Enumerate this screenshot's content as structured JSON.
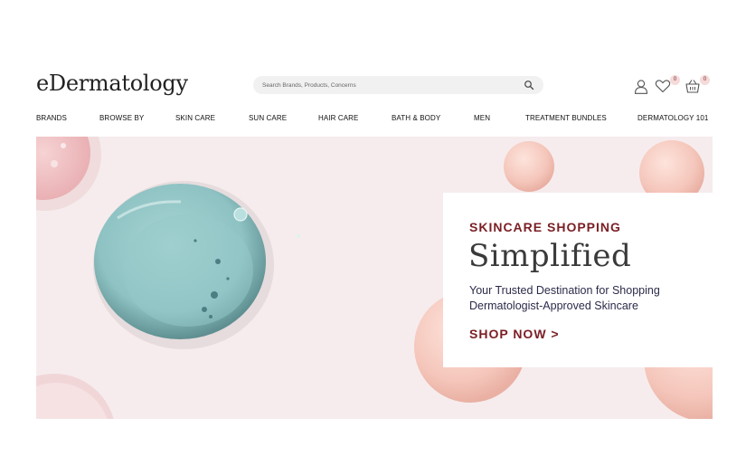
{
  "brand": {
    "logo_text": "eDermatology"
  },
  "search": {
    "placeholder": "Search Brands, Products, Concerns",
    "value": "",
    "icon": "search-icon"
  },
  "header_icons": {
    "account_icon": "user-icon",
    "wishlist_icon": "heart-icon",
    "wishlist_count": "0",
    "cart_icon": "basket-icon",
    "cart_count": "0"
  },
  "nav": {
    "items": [
      {
        "label": "BRANDS"
      },
      {
        "label": "BROWSE BY"
      },
      {
        "label": "SKIN CARE"
      },
      {
        "label": "SUN CARE"
      },
      {
        "label": "HAIR CARE"
      },
      {
        "label": "BATH & BODY"
      },
      {
        "label": "MEN"
      },
      {
        "label": "TREATMENT BUNDLES"
      },
      {
        "label": "DERMATOLOGY 101"
      }
    ]
  },
  "hero": {
    "kicker": "SKINCARE SHOPPING",
    "title": "Simplified",
    "text_line1": "Your Trusted Destination for Shopping",
    "text_line2": "Dermatologist-Approved Skincare",
    "cta": "SHOP NOW >"
  },
  "colors": {
    "accent": "#7a1f24",
    "hero_background": "#f6eced",
    "serum_drop": "#8fc3c4",
    "peach_drop": "#f3c6bd"
  }
}
